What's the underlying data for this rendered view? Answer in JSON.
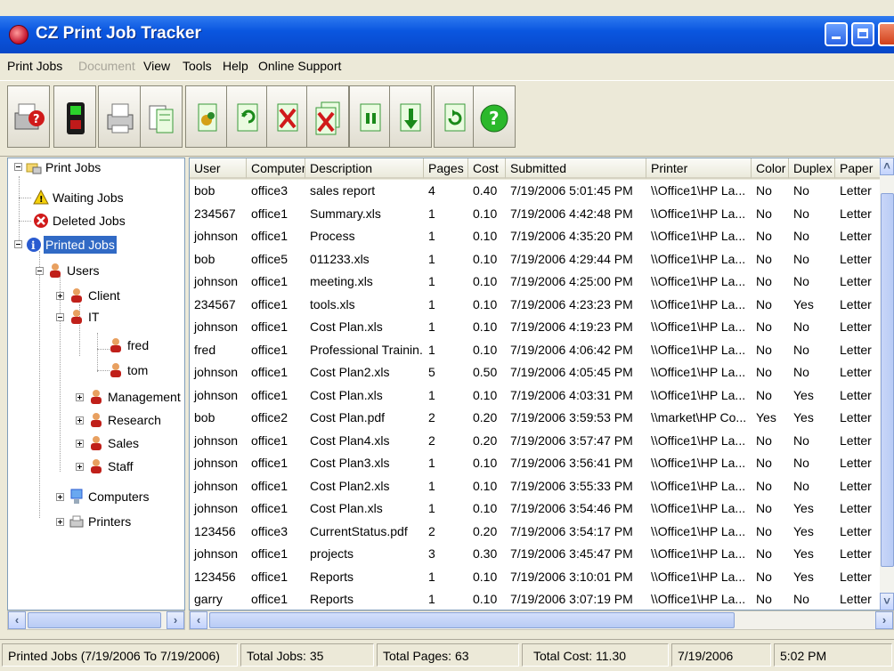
{
  "window": {
    "title": "CZ Print Job Tracker",
    "accent_color": "#0a56e0"
  },
  "menu": [
    "Print Jobs",
    "Document",
    "View",
    "Tools",
    "Help",
    "Online Support"
  ],
  "menu_disabled": [
    "Document"
  ],
  "toolbar": [
    {
      "icon": "printer-help-icon"
    },
    {
      "icon": "device-green-icon"
    },
    {
      "icon": "printer-icon"
    },
    {
      "icon": "documents-icon"
    },
    {
      "icon": "document-edit-icon"
    },
    {
      "icon": "refresh-icon"
    },
    {
      "icon": "delete-icon"
    },
    {
      "icon": "delete-all-icon"
    },
    {
      "icon": "pause-icon"
    },
    {
      "icon": "download-icon"
    },
    {
      "icon": "reload-icon"
    },
    {
      "icon": "help-icon"
    }
  ],
  "tree": {
    "root": "Print Jobs",
    "waiting": "Waiting Jobs",
    "deleted": "Deleted Jobs",
    "printed": "Printed Jobs",
    "users": "Users",
    "client": "Client",
    "it": "IT",
    "fred": "fred",
    "tom": "tom",
    "management": "Management",
    "research": "Research",
    "sales": "Sales",
    "staff": "Staff",
    "computers": "Computers",
    "printers": "Printers"
  },
  "grid": {
    "columns": [
      "User",
      "Computer",
      "Description",
      "Pages",
      "Cost",
      "Submitted",
      "Printer",
      "Color",
      "Duplex",
      "Paper"
    ],
    "rows": [
      [
        "bob",
        "office3",
        "sales report",
        "4",
        "0.40",
        "7/19/2006 5:01:45 PM",
        "\\\\Office1\\HP La...",
        "No",
        "No",
        "Letter"
      ],
      [
        "234567",
        "office1",
        "Summary.xls",
        "1",
        "0.10",
        "7/19/2006 4:42:48 PM",
        "\\\\Office1\\HP La...",
        "No",
        "No",
        "Letter"
      ],
      [
        "johnson",
        "office1",
        "Process",
        "1",
        "0.10",
        "7/19/2006 4:35:20 PM",
        "\\\\Office1\\HP La...",
        "No",
        "No",
        "Letter"
      ],
      [
        "bob",
        "office5",
        "011233.xls",
        "1",
        "0.10",
        "7/19/2006 4:29:44 PM",
        "\\\\Office1\\HP La...",
        "No",
        "No",
        "Letter"
      ],
      [
        "johnson",
        "office1",
        "meeting.xls",
        "1",
        "0.10",
        "7/19/2006 4:25:00 PM",
        "\\\\Office1\\HP La...",
        "No",
        "No",
        "Letter"
      ],
      [
        "234567",
        "office1",
        "tools.xls",
        "1",
        "0.10",
        "7/19/2006 4:23:23 PM",
        "\\\\Office1\\HP La...",
        "No",
        "Yes",
        "Letter"
      ],
      [
        "johnson",
        "office1",
        "Cost Plan.xls",
        "1",
        "0.10",
        "7/19/2006 4:19:23 PM",
        "\\\\Office1\\HP La...",
        "No",
        "No",
        "Letter"
      ],
      [
        "fred",
        "office1",
        "Professional Trainin...",
        "1",
        "0.10",
        "7/19/2006 4:06:42 PM",
        "\\\\Office1\\HP La...",
        "No",
        "No",
        "Letter"
      ],
      [
        "johnson",
        "office1",
        "Cost Plan2.xls",
        "5",
        "0.50",
        "7/19/2006 4:05:45 PM",
        "\\\\Office1\\HP La...",
        "No",
        "No",
        "Letter"
      ],
      [
        "johnson",
        "office1",
        "Cost Plan.xls",
        "1",
        "0.10",
        "7/19/2006 4:03:31 PM",
        "\\\\Office1\\HP La...",
        "No",
        "Yes",
        "Letter"
      ],
      [
        "bob",
        "office2",
        "Cost Plan.pdf",
        "2",
        "0.20",
        "7/19/2006 3:59:53 PM",
        "\\\\market\\HP Co...",
        "Yes",
        "Yes",
        "Letter"
      ],
      [
        "johnson",
        "office1",
        "Cost Plan4.xls",
        "2",
        "0.20",
        "7/19/2006 3:57:47 PM",
        "\\\\Office1\\HP La...",
        "No",
        "No",
        "Letter"
      ],
      [
        "johnson",
        "office1",
        "Cost Plan3.xls",
        "1",
        "0.10",
        "7/19/2006 3:56:41 PM",
        "\\\\Office1\\HP La...",
        "No",
        "No",
        "Letter"
      ],
      [
        "johnson",
        "office1",
        "Cost Plan2.xls",
        "1",
        "0.10",
        "7/19/2006 3:55:33 PM",
        "\\\\Office1\\HP La...",
        "No",
        "No",
        "Letter"
      ],
      [
        "johnson",
        "office1",
        "Cost Plan.xls",
        "1",
        "0.10",
        "7/19/2006 3:54:46 PM",
        "\\\\Office1\\HP La...",
        "No",
        "Yes",
        "Letter"
      ],
      [
        "123456",
        "office3",
        "CurrentStatus.pdf",
        "2",
        "0.20",
        "7/19/2006 3:54:17 PM",
        "\\\\Office1\\HP La...",
        "No",
        "Yes",
        "Letter"
      ],
      [
        "johnson",
        "office1",
        "projects",
        "3",
        "0.30",
        "7/19/2006 3:45:47 PM",
        "\\\\Office1\\HP La...",
        "No",
        "Yes",
        "Letter"
      ],
      [
        "123456",
        "office1",
        "Reports",
        "1",
        "0.10",
        "7/19/2006 3:10:01 PM",
        "\\\\Office1\\HP La...",
        "No",
        "Yes",
        "Letter"
      ],
      [
        "garry",
        "office1",
        "Reports",
        "1",
        "0.10",
        "7/19/2006 3:07:19 PM",
        "\\\\Office1\\HP La...",
        "No",
        "No",
        "Letter"
      ]
    ]
  },
  "status": {
    "range": "Printed Jobs (7/19/2006 To 7/19/2006)",
    "total_jobs": "Total Jobs: 35",
    "total_pages": "Total Pages: 63",
    "total_cost": "Total Cost: 11.30",
    "date": "7/19/2006",
    "time": "5:02 PM"
  }
}
